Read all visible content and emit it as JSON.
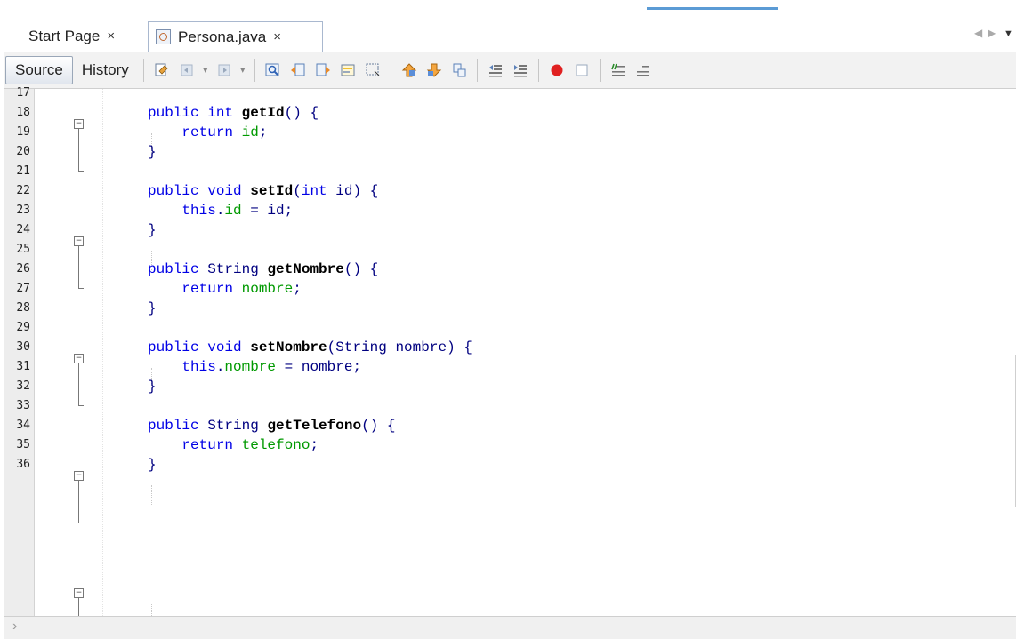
{
  "tabs": [
    {
      "label": "Start Page",
      "close": "×"
    },
    {
      "label": "Persona.java",
      "close": "×",
      "icon": "java-file-icon"
    }
  ],
  "toolbar": {
    "source_label": "Source",
    "history_label": "History",
    "icons": [
      "last-edit-icon",
      "back-icon",
      "forward-icon",
      "find-icon",
      "find-previous-icon",
      "find-next-icon",
      "toggle-highlight-icon",
      "toggle-rect-select-icon",
      "previous-bookmark-icon",
      "next-bookmark-icon",
      "toggle-bookmark-icon",
      "shift-left-icon",
      "shift-right-icon",
      "start-macro-icon",
      "stop-macro-icon",
      "comment-icon",
      "uncomment-icon"
    ]
  },
  "colors": {
    "keyword": "#0000e6",
    "field": "#009900",
    "text": "#000080"
  },
  "code_lines": [
    {
      "n": "17",
      "parts": []
    },
    {
      "n": "18",
      "parts": [
        [
          "kw",
          "public int "
        ],
        [
          "mth",
          "getId"
        ],
        [
          "t",
          "() {"
        ]
      ]
    },
    {
      "n": "19",
      "parts": [
        [
          "t",
          "    "
        ],
        [
          "kw",
          "return "
        ],
        [
          "fld",
          "id"
        ],
        [
          "t",
          ";"
        ]
      ]
    },
    {
      "n": "20",
      "parts": [
        [
          "t",
          "}"
        ]
      ]
    },
    {
      "n": "21",
      "parts": []
    },
    {
      "n": "22",
      "parts": [
        [
          "kw",
          "public void "
        ],
        [
          "mth",
          "setId"
        ],
        [
          "t",
          "("
        ],
        [
          "kw",
          "int "
        ],
        [
          "t",
          "id) {"
        ]
      ]
    },
    {
      "n": "23",
      "parts": [
        [
          "t",
          "    "
        ],
        [
          "kw",
          "this"
        ],
        [
          "t",
          "."
        ],
        [
          "fld",
          "id"
        ],
        [
          "t",
          " = id;"
        ]
      ]
    },
    {
      "n": "24",
      "parts": [
        [
          "t",
          "}"
        ]
      ]
    },
    {
      "n": "25",
      "parts": []
    },
    {
      "n": "26",
      "parts": [
        [
          "kw",
          "public "
        ],
        [
          "t",
          "String "
        ],
        [
          "mth",
          "getNombre"
        ],
        [
          "t",
          "() {"
        ]
      ]
    },
    {
      "n": "27",
      "parts": [
        [
          "t",
          "    "
        ],
        [
          "kw",
          "return "
        ],
        [
          "fld",
          "nombre"
        ],
        [
          "t",
          ";"
        ]
      ]
    },
    {
      "n": "28",
      "parts": [
        [
          "t",
          "}"
        ]
      ]
    },
    {
      "n": "29",
      "parts": []
    },
    {
      "n": "30",
      "parts": [
        [
          "kw",
          "public void "
        ],
        [
          "mth",
          "setNombre"
        ],
        [
          "t",
          "(String nombre) {"
        ]
      ]
    },
    {
      "n": "31",
      "parts": [
        [
          "t",
          "    "
        ],
        [
          "kw",
          "this"
        ],
        [
          "t",
          "."
        ],
        [
          "fld",
          "nombre"
        ],
        [
          "t",
          " = nombre;"
        ]
      ]
    },
    {
      "n": "32",
      "parts": [
        [
          "t",
          "}"
        ]
      ]
    },
    {
      "n": "33",
      "parts": []
    },
    {
      "n": "34",
      "parts": [
        [
          "kw",
          "public "
        ],
        [
          "t",
          "String "
        ],
        [
          "mth",
          "getTelefono"
        ],
        [
          "t",
          "() {"
        ]
      ]
    },
    {
      "n": "35",
      "parts": [
        [
          "t",
          "    "
        ],
        [
          "kw",
          "return "
        ],
        [
          "fld",
          "telefono"
        ],
        [
          "t",
          ";"
        ]
      ]
    },
    {
      "n": "36",
      "parts": [
        [
          "t",
          "}"
        ]
      ]
    }
  ]
}
